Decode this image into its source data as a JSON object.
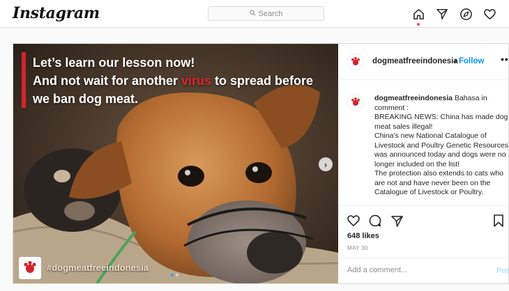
{
  "topbar": {
    "logo": "Instagram",
    "search_placeholder": "Search",
    "nav_icons": [
      "home-icon",
      "direct-icon",
      "explore-icon",
      "activity-icon"
    ]
  },
  "photo": {
    "overlay_line1": "Let’s learn our lesson now!",
    "overlay_line2a": "And not wait for another ",
    "overlay_line2_highlight": "virus",
    "overlay_line2b": " to spread before",
    "overlay_line3": "we ban dog meat.",
    "hashtag": "#dogmeatfreeindonesia",
    "highlight_color": "#e0262c",
    "next_icon": "chevron-right-icon"
  },
  "header": {
    "username": "dogmeatfreeindonesia",
    "separator": "•",
    "follow_label": "Follow",
    "more_icon": "more-icon",
    "more_glyph": "•••"
  },
  "comment": {
    "username": "dogmeatfreeindonesia",
    "lines": [
      "Bahasa in comment :",
      "BREAKING NEWS: China has made dog meat sales illegal!",
      "China's new National Catalogue of Livestock and Poultry Genetic Resources was announced today and dogs were no longer included on the list!",
      "The protection also extends to cats who are not and have never been on the Catalogue of Livestock or Poultry."
    ]
  },
  "actions": {
    "likes": "648 likes",
    "date": "MAY 30",
    "add_comment_placeholder": "Add a comment...",
    "post_label": "Post"
  },
  "colors": {
    "accent": "#0095f6",
    "post_disabled": "#b2dffc",
    "notification_dot": "#ed4956"
  }
}
